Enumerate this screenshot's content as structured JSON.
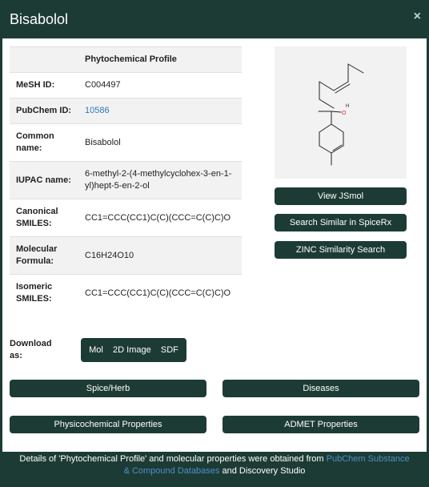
{
  "modal": {
    "title": "Bisabolol",
    "close_label": "×"
  },
  "profile": {
    "header": "Phytochemical Profile",
    "rows": [
      {
        "key": "MeSH ID:",
        "value": "C004497"
      },
      {
        "key": "PubChem ID:",
        "value": "10586",
        "is_link": true
      },
      {
        "key": "Common name:",
        "value": "Bisabolol"
      },
      {
        "key": "IUPAC name:",
        "value": "6-methyl-2-(4-methylcyclohex-3-en-1-yl)hept-5-en-2-ol"
      },
      {
        "key": "Canonical SMILES:",
        "value": "CC1=CCC(CC1)C(C)(CCC=C(C)C)O"
      },
      {
        "key": "Molecular Formula:",
        "value": "C16H24O10"
      },
      {
        "key": "Isomeric SMILES:",
        "value": "CC1=CCC(CC1)C(C)(CCC=C(C)C)O"
      }
    ]
  },
  "structure": {
    "atom_o": "O",
    "atom_h": "H"
  },
  "side_buttons": {
    "jsmol": "View JSmol",
    "spicerx": "Search Similar in SpiceRx",
    "zinc": "ZINC Similarity Search"
  },
  "download": {
    "label": "Download as:",
    "options": [
      "Mol",
      "2D Image",
      "SDF"
    ]
  },
  "nav_buttons": {
    "spice_herb": "Spice/Herb",
    "diseases": "Diseases",
    "physicochemical": "Physicochemical Properties",
    "admet": "ADMET Properties"
  },
  "footer": {
    "prefix": "Details of 'Phytochemical Profile' and molecular properties were obtained from ",
    "link": "PubChem Substance & Compound Databases",
    "suffix": " and Discovery Studio"
  },
  "colors": {
    "primary": "#1d3b35",
    "link": "#2a7ab8",
    "stripe": "#f2f2f2",
    "oxygen": "#e02020"
  }
}
